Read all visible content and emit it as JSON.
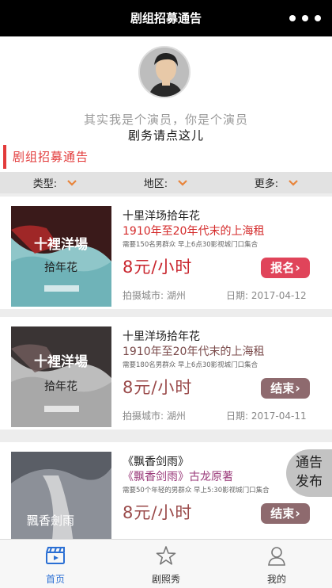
{
  "titlebar": {
    "title": "剧组招募通告",
    "more_icon": "more-dots-icon"
  },
  "hero": {
    "slogan": "其实我是个演员，你是个演员",
    "contact": "剧务请点这儿"
  },
  "section": {
    "label": "剧组招募通告",
    "accent": "#e23a3a"
  },
  "filters": [
    {
      "label": "类型:",
      "icon": "chevron-down-icon"
    },
    {
      "label": "地区:",
      "icon": "chevron-down-icon"
    },
    {
      "label": "更多:",
      "icon": "chevron-down-icon"
    }
  ],
  "cards": [
    {
      "name": "十里洋场拾年花",
      "subtitle": "1910年至20年代末的上海租",
      "requirement": "需要150名男群众  早上6点30影视城门口集合 ",
      "price": "8元/小时",
      "button": "报名",
      "status": "open",
      "city": "拍摄城市: 湖州",
      "date": "日期: 2017-04-12",
      "poster_text": "十裡洋場",
      "poster_sub": "拾年花"
    },
    {
      "name": "十里洋场拾年花",
      "subtitle": "1910年至20年代末的上海租",
      "requirement": "需要180名男群众  早上6点30影视城门口集合 ",
      "price": "8元/小时",
      "button": "结束",
      "status": "ended",
      "city": "拍摄城市: 湖州",
      "date": "日期: 2017-04-11",
      "poster_text": "十裡洋場",
      "poster_sub": "拾年花"
    },
    {
      "name": "《飘香剑雨》",
      "subtitle": "《飘香剑雨》古龙原著",
      "requirement": "需要50个年轻的男群众  早上5:30影视城门口集合 ",
      "price": "8元/小时",
      "button": "结束",
      "status": "ended",
      "city": "",
      "date": "",
      "poster_text": "飄香劍雨",
      "poster_sub": ""
    }
  ],
  "fab": {
    "line1": "通告",
    "line2": "发布"
  },
  "tabs": [
    {
      "label": "首页",
      "icon": "clapperboard-icon",
      "active": true
    },
    {
      "label": "剧照秀",
      "icon": "star-icon",
      "active": false
    },
    {
      "label": "我的",
      "icon": "user-icon",
      "active": false
    }
  ],
  "colors": {
    "accent_red": "#c9262e",
    "signup_button": "#e0445a",
    "ended_button": "#8e6a6e",
    "active_tab": "#2a6fd4"
  }
}
